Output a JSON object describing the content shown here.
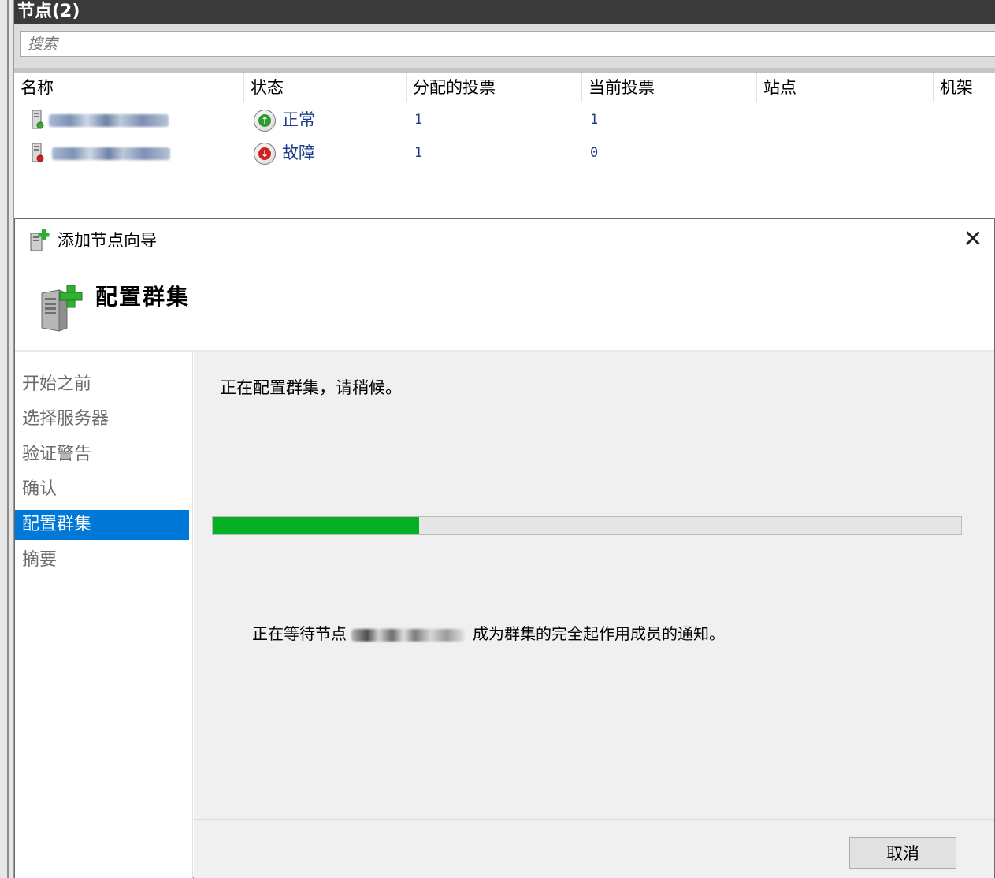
{
  "panel": {
    "title": "节点(2)",
    "search_placeholder": "搜索"
  },
  "table": {
    "columns": [
      "名称",
      "状态",
      "分配的投票",
      "当前投票",
      "站点",
      "机架"
    ],
    "rows": [
      {
        "name": "",
        "status": "正常",
        "status_kind": "up",
        "assigned_votes": "1",
        "current_votes": "1"
      },
      {
        "name": "",
        "status": "故障",
        "status_kind": "down",
        "assigned_votes": "1",
        "current_votes": "0"
      }
    ]
  },
  "wizard": {
    "title": "添加节点向导",
    "close_glyph": "✕",
    "heading": "配置群集",
    "steps": [
      "开始之前",
      "选择服务器",
      "验证警告",
      "确认",
      "配置群集",
      "摘要"
    ],
    "active_step_index": 4,
    "status_message": "正在配置群集，请稍候。",
    "progress_fraction": 0.276,
    "wait_message_prefix": "正在等待节点",
    "wait_message_suffix": "成为群集的完全起作用成员的通知。",
    "cancel_label": "取消"
  },
  "colors": {
    "accent": "#0078d7",
    "progress": "#06b025",
    "status_up": "#2e9b2e",
    "status_down": "#d22020",
    "title_bar": "#3a3a3a"
  }
}
